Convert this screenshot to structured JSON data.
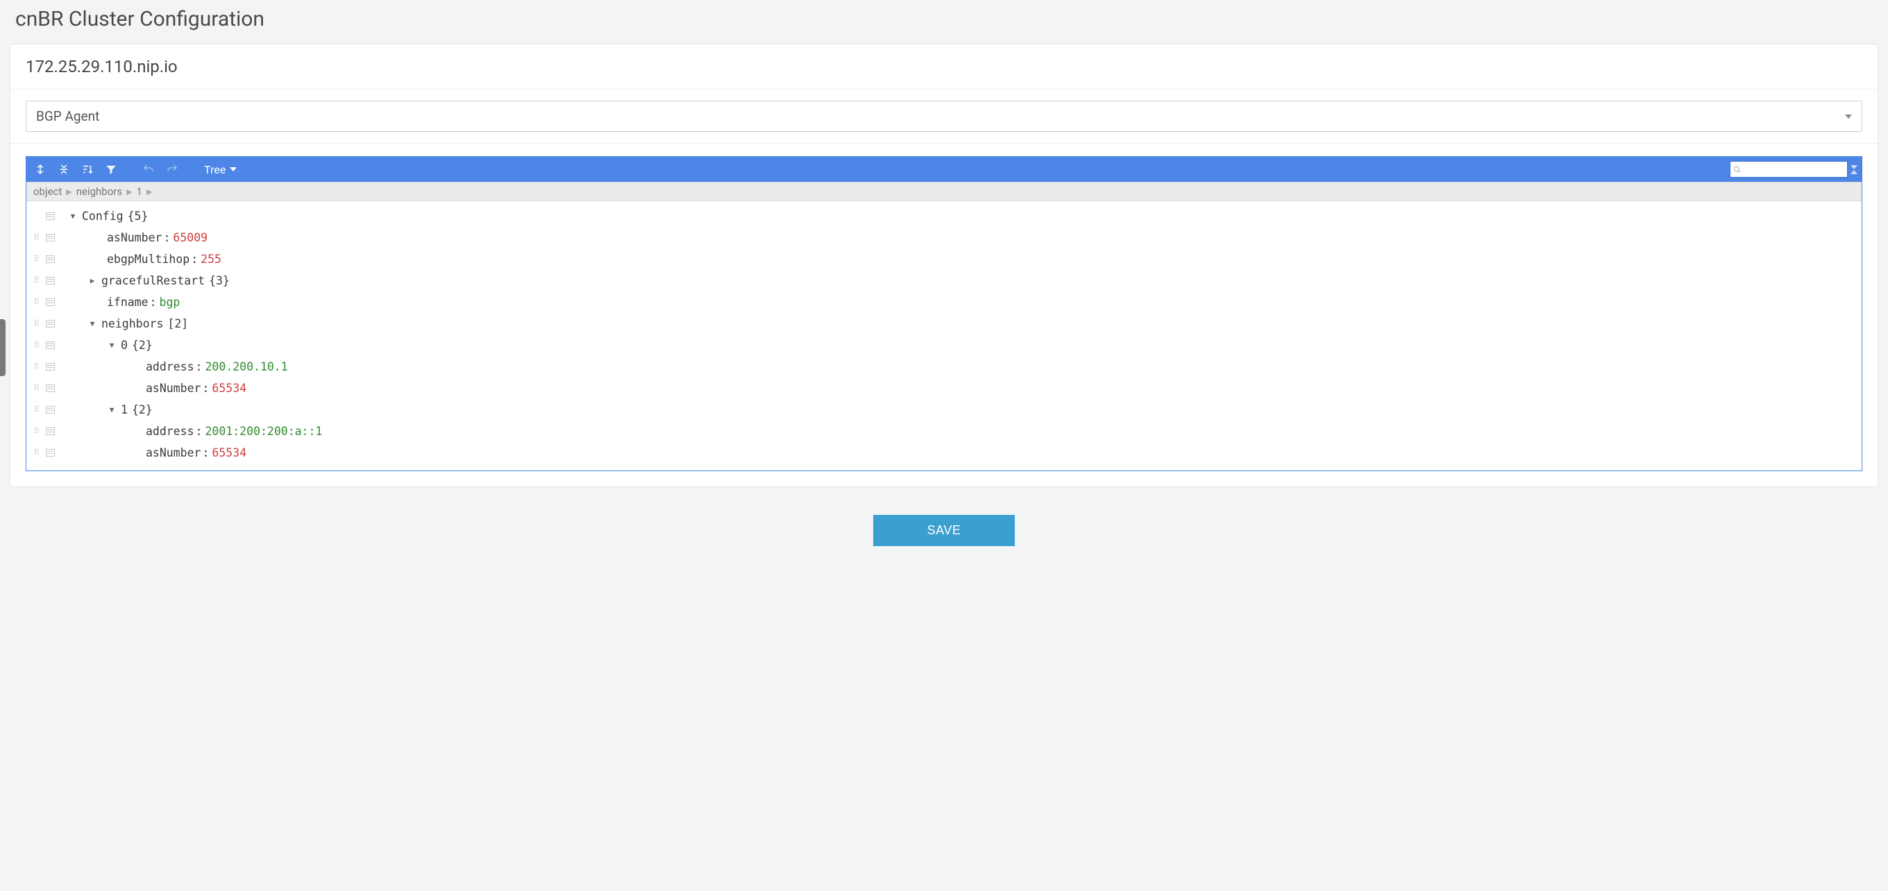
{
  "page": {
    "title": "cnBR Cluster Configuration",
    "host": "172.25.29.110.nip.io",
    "selector_value": "BGP Agent"
  },
  "toolbar": {
    "view_mode": "Tree",
    "search_placeholder": ""
  },
  "breadcrumb": {
    "a": "object",
    "b": "neighbors",
    "c": "1"
  },
  "tree": {
    "root_key": "Config",
    "root_meta": "{5}",
    "asNumber": {
      "k": "asNumber",
      "v": "65009"
    },
    "ebgpMultihop": {
      "k": "ebgpMultihop",
      "v": "255"
    },
    "gracefulRestart": {
      "k": "gracefulRestart",
      "meta": "{3}"
    },
    "ifname": {
      "k": "ifname",
      "v": "bgp"
    },
    "neighbors": {
      "k": "neighbors",
      "meta": "[2]"
    },
    "n0": {
      "k": "0",
      "meta": "{2}"
    },
    "n0address": {
      "k": "address",
      "v": "200.200.10.1"
    },
    "n0asNumber": {
      "k": "asNumber",
      "v": "65534"
    },
    "n1": {
      "k": "1",
      "meta": "{2}"
    },
    "n1address": {
      "k": "address",
      "v": "2001:200:200:a::1"
    },
    "n1asNumber": {
      "k": "asNumber",
      "v": "65534"
    }
  },
  "actions": {
    "save": "SAVE"
  }
}
